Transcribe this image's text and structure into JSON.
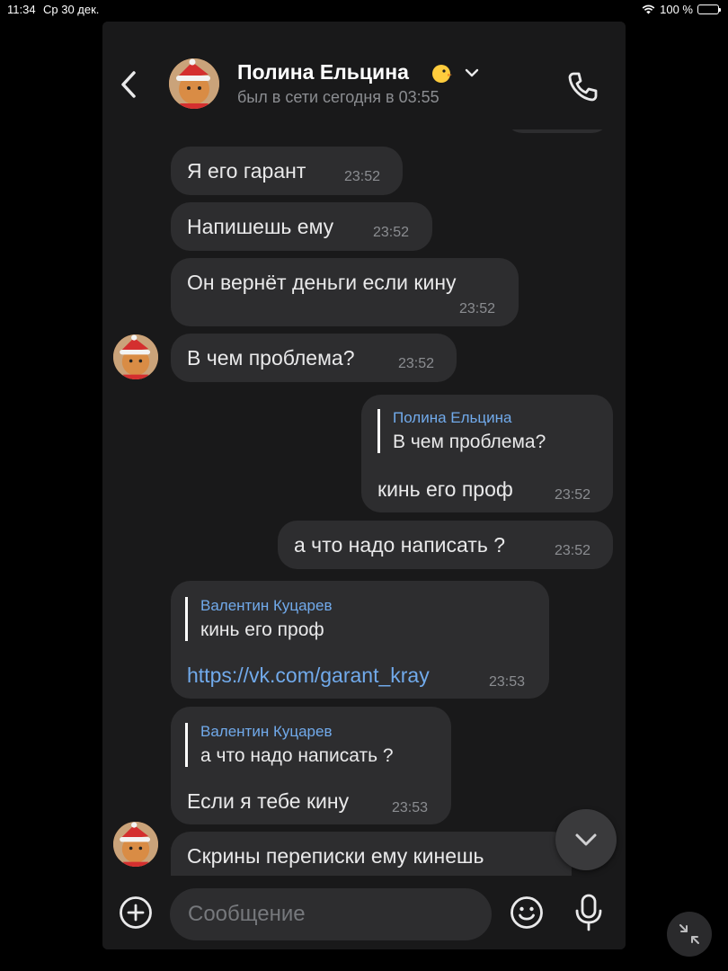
{
  "status_bar": {
    "time": "11:34",
    "date": "Ср 30 дек.",
    "battery": "100 %"
  },
  "header": {
    "name": "Полина Ельцина",
    "emoji": "🐥",
    "last_seen": "был в сети сегодня в 03:55"
  },
  "messages": [
    {
      "text": "Я его гарант",
      "time": "23:52"
    },
    {
      "text": "Напишешь ему",
      "time": "23:52"
    },
    {
      "text": "Он вернёт деньги если кину",
      "time": "23:52"
    },
    {
      "text": "В чем проблема?",
      "time": "23:52"
    },
    {
      "reply_name": "Полина Ельцина",
      "reply_text": "В чем проблема?",
      "text": "кинь его проф",
      "time": "23:52"
    },
    {
      "text": "а что надо написать ?",
      "time": "23:52"
    },
    {
      "reply_name": "Валентин Куцарев",
      "reply_text": "кинь его проф",
      "link": "https://vk.com/garant_kray",
      "time": "23:53"
    },
    {
      "reply_name": "Валентин Куцарев",
      "reply_text": "а что надо написать ?",
      "text": "Если я тебе кину",
      "time": "23:53"
    },
    {
      "text": "Скрины переписки ему кинешь"
    }
  ],
  "composer": {
    "placeholder": "Сообщение"
  },
  "icons": {
    "back": "chevron-left-icon",
    "call": "phone-icon",
    "attach": "plus-circle-icon",
    "emoji": "smile-icon",
    "voice": "microphone-icon",
    "scroll": "chevron-down-icon",
    "collapse": "collapse-arrows-icon"
  },
  "colors": {
    "background": "#19191a",
    "bubble": "#2d2d2f",
    "link": "#71aaeb",
    "secondary_text": "#8b8d91"
  }
}
